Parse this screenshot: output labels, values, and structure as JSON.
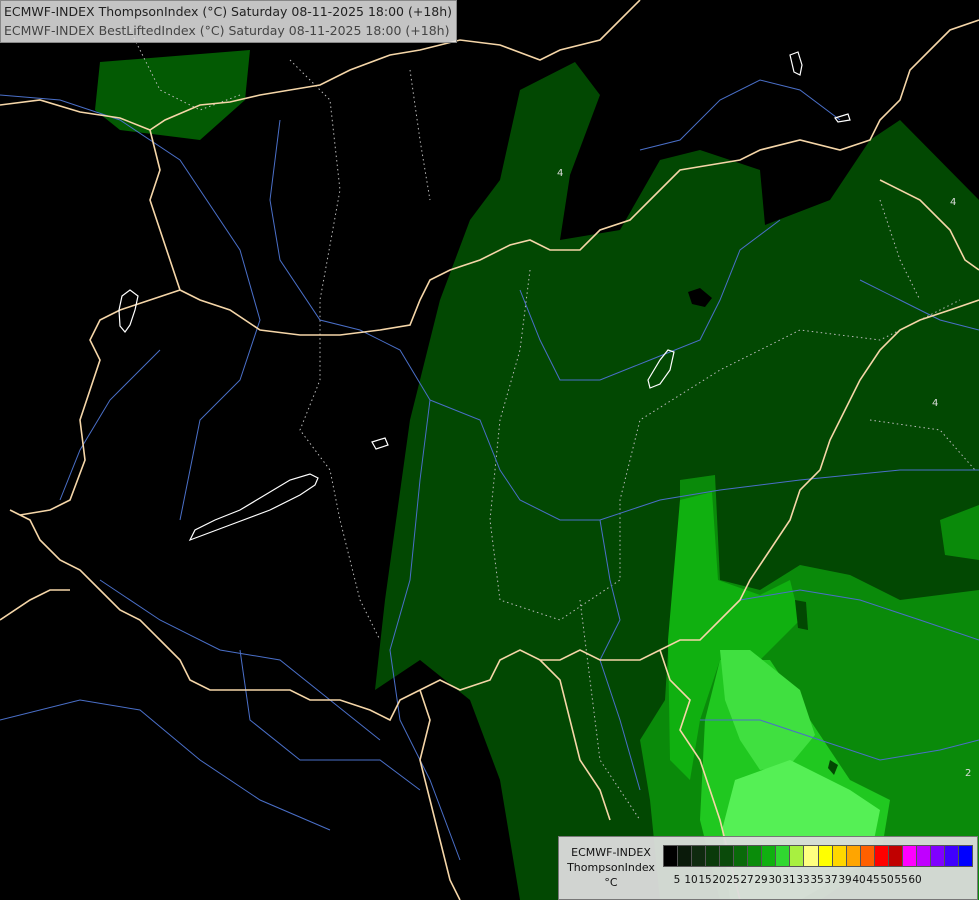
{
  "header": {
    "line1": "ECMWF-INDEX ThompsonIndex (°C) Saturday 08-11-2025 18:00 (+18h)",
    "line2": "ECMWF-INDEX BestLiftedIndex (°C) Saturday 08-11-2025 18:00 (+18h)"
  },
  "legend": {
    "line1": "ECMWF-INDEX",
    "line2": "ThompsonIndex",
    "unit": "°C",
    "colors": [
      "#000000",
      "#0a1a0a",
      "#0f2a0f",
      "#0a3a0a",
      "#0a4a0a",
      "#0a6a0a",
      "#0a8c0a",
      "#10b010",
      "#30d830",
      "#a8f040",
      "#ffff80",
      "#ffff00",
      "#ffd700",
      "#ffa500",
      "#ff6000",
      "#ff0000",
      "#c00000",
      "#ff00ff",
      "#c000ff",
      "#8000ff",
      "#4000ff",
      "#0000ff"
    ],
    "ticks": [
      "5",
      "10",
      "15",
      "20",
      "25",
      "27",
      "29",
      "30",
      "31",
      "33",
      "35",
      "37",
      "39",
      "40",
      "45",
      "50",
      "55",
      "60"
    ]
  },
  "contours": {
    "labels": [
      "4",
      "4",
      "4",
      "2"
    ]
  },
  "colors": {
    "borders": "#f5d6a8",
    "rivers": "#4a6fc8",
    "lakes": "#ffffff",
    "contour_dotted": "#cccccc",
    "fill_darkgreen": "#024802",
    "fill_green": "#005f00",
    "fill_mid": "#0a9a0a",
    "fill_light": "#22cc22",
    "fill_bright": "#44ee44"
  }
}
